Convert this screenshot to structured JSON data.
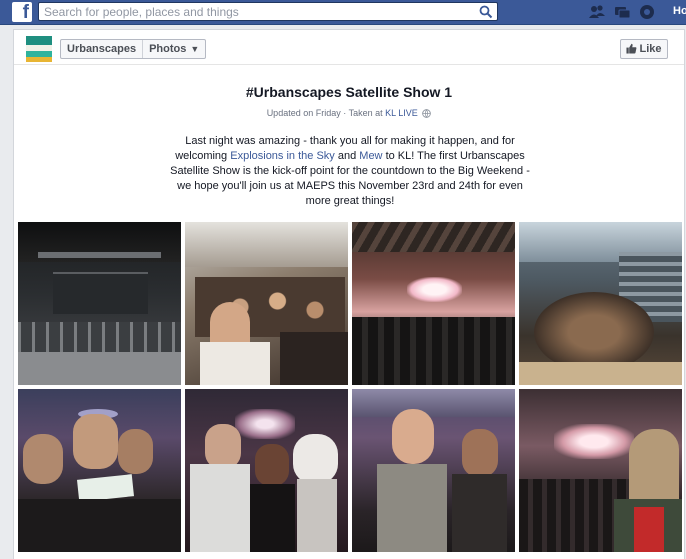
{
  "topbar": {
    "logo": "f",
    "search_placeholder": "Search for people, places and things",
    "home": "Ho",
    "icons": [
      "friend-requests-icon",
      "messages-icon",
      "notifications-icon"
    ]
  },
  "header": {
    "breadcrumb_page": "Urbanscapes",
    "breadcrumb_section": "Photos",
    "like_label": "Like"
  },
  "album": {
    "title": "#Urbanscapes Satellite Show 1",
    "updated": "Updated on Friday · Taken at",
    "location": "KL LIVE",
    "desc_1": "Last night was amazing - thank you all for making it happen, and for welcoming",
    "link_1": "Explosions in the Sky",
    "desc_2": "and",
    "link_2": "Mew",
    "desc_3": "to KL! The first Urbanscapes Satellite Show is the kick-off point for the countdown to the Big Weekend - we hope you'll join us at MAEPS this November 23rd and 24th for even more great things!"
  },
  "photos": [
    {
      "name": "photo-empty-stage"
    },
    {
      "name": "photo-crowd-selfie"
    },
    {
      "name": "photo-stage-lights"
    },
    {
      "name": "photo-venue-overhead"
    },
    {
      "name": "photo-fans-with-ticket"
    },
    {
      "name": "photo-heisenberg-group"
    },
    {
      "name": "photo-smiling-couple"
    },
    {
      "name": "photo-horse-mask"
    }
  ],
  "colors": {
    "brand": "#3b5998",
    "link": "#3b5998",
    "background": "#e9ebee"
  }
}
